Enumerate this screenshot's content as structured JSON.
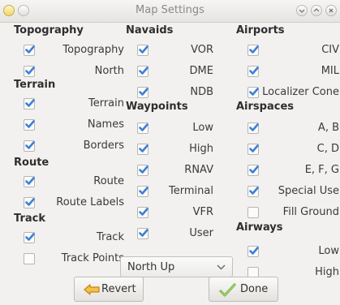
{
  "window": {
    "title": "Map Settings"
  },
  "columns": [
    {
      "groups": [
        {
          "header": "Topography",
          "items": [
            {
              "label": "Topography",
              "checked": true
            },
            {
              "label": "North",
              "checked": true
            }
          ]
        },
        {
          "header": "Terrain",
          "items": [
            {
              "label": "Terrain",
              "checked": true
            },
            {
              "label": "Names",
              "checked": true
            },
            {
              "label": "Borders",
              "checked": true
            }
          ]
        },
        {
          "header": "Route",
          "items": [
            {
              "label": "Route",
              "checked": true
            },
            {
              "label": "Route Labels",
              "checked": true
            }
          ]
        },
        {
          "header": "Track",
          "items": [
            {
              "label": "Track",
              "checked": true
            },
            {
              "label": "Track Points",
              "checked": false
            }
          ]
        }
      ]
    },
    {
      "groups": [
        {
          "header": "Navaids",
          "items": [
            {
              "label": "VOR",
              "checked": true
            },
            {
              "label": "DME",
              "checked": true
            },
            {
              "label": "NDB",
              "checked": true
            }
          ]
        },
        {
          "header": "Waypoints",
          "items": [
            {
              "label": "Low",
              "checked": true
            },
            {
              "label": "High",
              "checked": true
            },
            {
              "label": "RNAV",
              "checked": true
            },
            {
              "label": "Terminal",
              "checked": true
            },
            {
              "label": "VFR",
              "checked": true
            },
            {
              "label": "User",
              "checked": true
            }
          ]
        }
      ]
    },
    {
      "groups": [
        {
          "header": "Airports",
          "items": [
            {
              "label": "CIV",
              "checked": true
            },
            {
              "label": "MIL",
              "checked": true
            },
            {
              "label": "Localizer Cone",
              "checked": true
            }
          ]
        },
        {
          "header": "Airspaces",
          "items": [
            {
              "label": "A, B",
              "checked": true
            },
            {
              "label": "C, D",
              "checked": true
            },
            {
              "label": "E, F, G",
              "checked": true
            },
            {
              "label": "Special Use",
              "checked": true
            },
            {
              "label": "Fill Ground",
              "checked": false
            }
          ]
        },
        {
          "header": "Airways",
          "items": [
            {
              "label": "Low",
              "checked": true
            },
            {
              "label": "High",
              "checked": false
            }
          ]
        }
      ]
    }
  ],
  "orientation_select": {
    "value": "North Up"
  },
  "buttons": {
    "revert": "Revert",
    "done": "Done"
  },
  "colors": {
    "check": "#3d7fd6",
    "done_icon": "#7ac043",
    "revert_icon": "#e8a21a"
  }
}
